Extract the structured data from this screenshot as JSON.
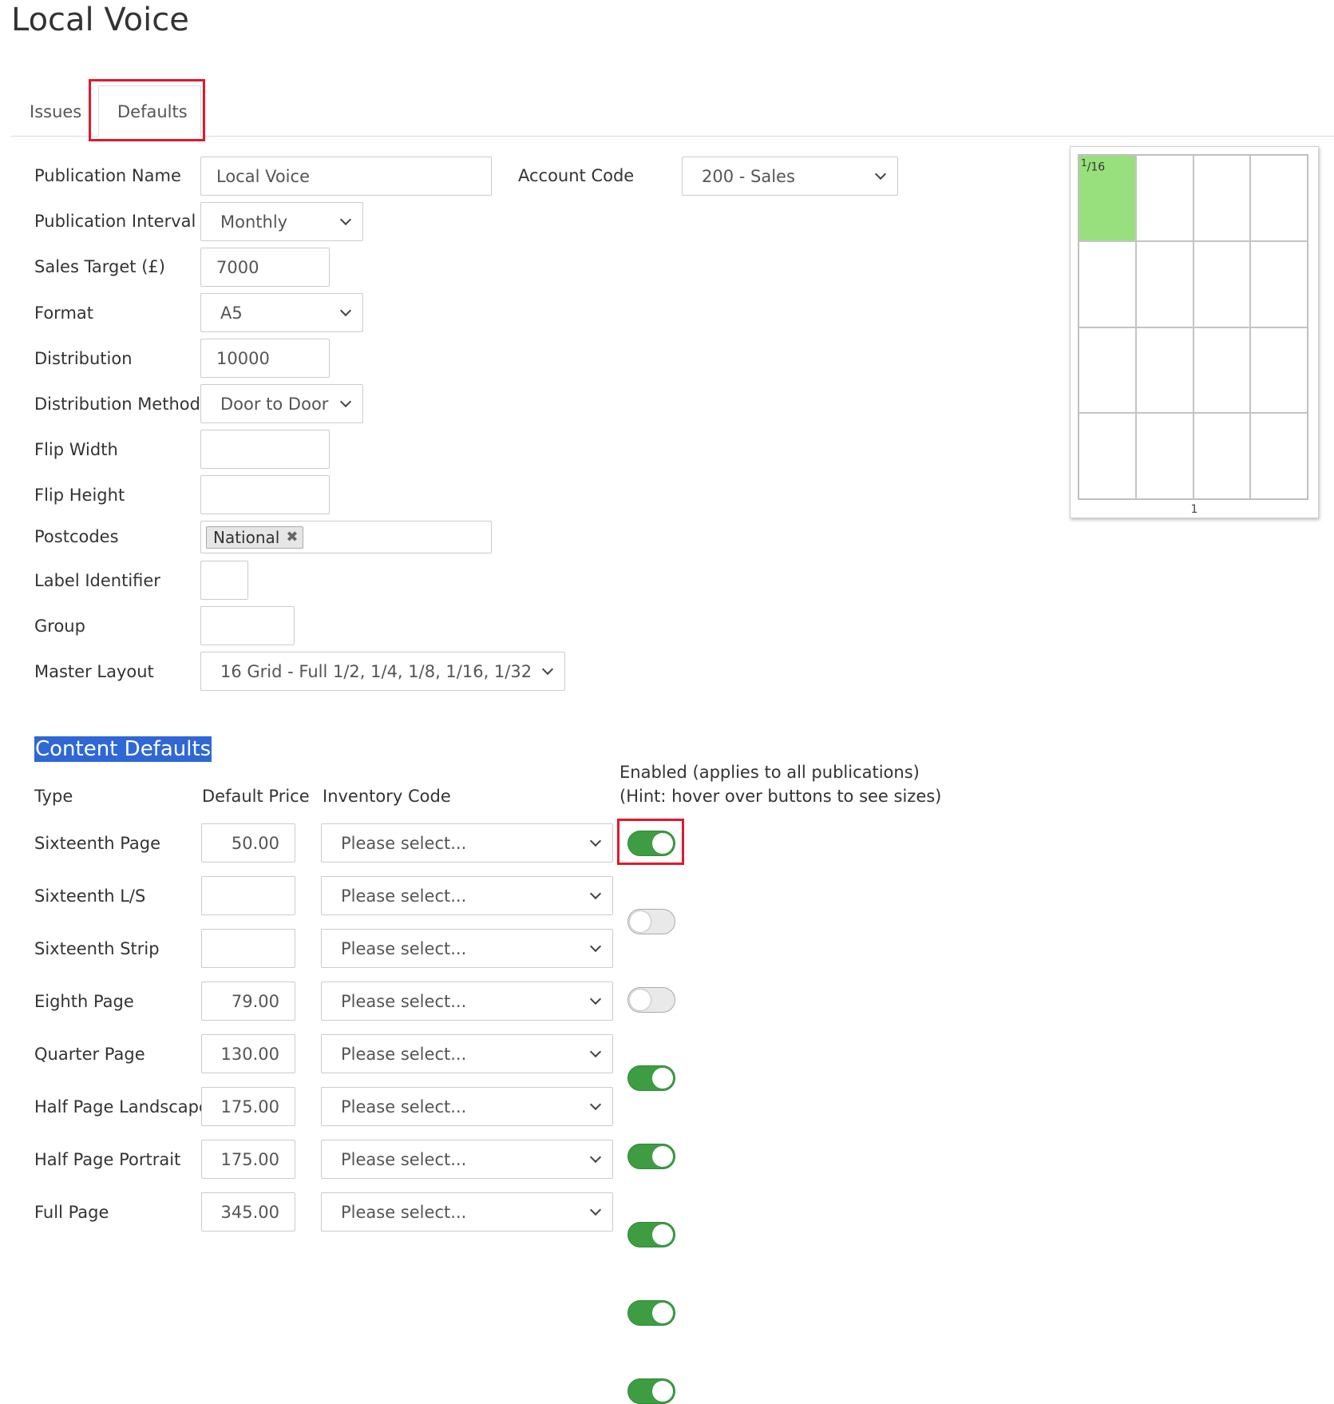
{
  "title": "Local Voice",
  "tabs": [
    {
      "label": "Issues",
      "active": false
    },
    {
      "label": "Defaults",
      "active": true
    }
  ],
  "form": {
    "publication_name": {
      "label": "Publication Name",
      "value": "Local Voice"
    },
    "account_code": {
      "label": "Account Code",
      "value": "200 - Sales"
    },
    "publication_interval": {
      "label": "Publication Interval",
      "value": "Monthly"
    },
    "sales_target": {
      "label": "Sales Target (£)",
      "value": "7000"
    },
    "format": {
      "label": "Format",
      "value": "A5"
    },
    "distribution": {
      "label": "Distribution",
      "value": "10000"
    },
    "distribution_method": {
      "label": "Distribution Method",
      "value": "Door to Door"
    },
    "flip_width": {
      "label": "Flip Width",
      "value": ""
    },
    "flip_height": {
      "label": "Flip Height",
      "value": ""
    },
    "postcodes": {
      "label": "Postcodes",
      "tags": [
        "National"
      ],
      "remove_glyph": "✖"
    },
    "label_identifier": {
      "label": "Label Identifier",
      "value": ""
    },
    "group": {
      "label": "Group",
      "value": ""
    },
    "master_layout": {
      "label": "Master Layout",
      "value": "16 Grid - Full 1/2, 1/4, 1/8, 1/16, 1/32"
    }
  },
  "content_defaults": {
    "heading": "Content Defaults",
    "columns": {
      "type": "Type",
      "default_price": "Default Price",
      "inventory_code": "Inventory Code",
      "enabled_line1": "Enabled (applies to all publications)",
      "enabled_line2": "(Hint: hover over buttons to see sizes)"
    },
    "rows": [
      {
        "type": "Sixteenth Page",
        "price": "50.00",
        "inventory": "Please select...",
        "enabled": true
      },
      {
        "type": "Sixteenth L/S",
        "price": "",
        "inventory": "Please select...",
        "enabled": false
      },
      {
        "type": "Sixteenth Strip",
        "price": "",
        "inventory": "Please select...",
        "enabled": false
      },
      {
        "type": "Eighth Page",
        "price": "79.00",
        "inventory": "Please select...",
        "enabled": true
      },
      {
        "type": "Quarter Page",
        "price": "130.00",
        "inventory": "Please select...",
        "enabled": true
      },
      {
        "type": "Half Page Landscape",
        "price": "175.00",
        "inventory": "Please select...",
        "enabled": true
      },
      {
        "type": "Half Page Portrait",
        "price": "175.00",
        "inventory": "Please select...",
        "enabled": true
      },
      {
        "type": "Full Page",
        "price": "345.00",
        "inventory": "Please select...",
        "enabled": true
      }
    ]
  },
  "layout_preview": {
    "fraction_numerator": "1",
    "fraction_denominator": "16",
    "page_number": "1",
    "highlight_color": "#98df7d",
    "rows": 4,
    "cols": 4
  },
  "colors": {
    "accent_red": "#e3182d",
    "toggle_on": "#3e9c43",
    "heading_highlight": "#2f67d6"
  }
}
